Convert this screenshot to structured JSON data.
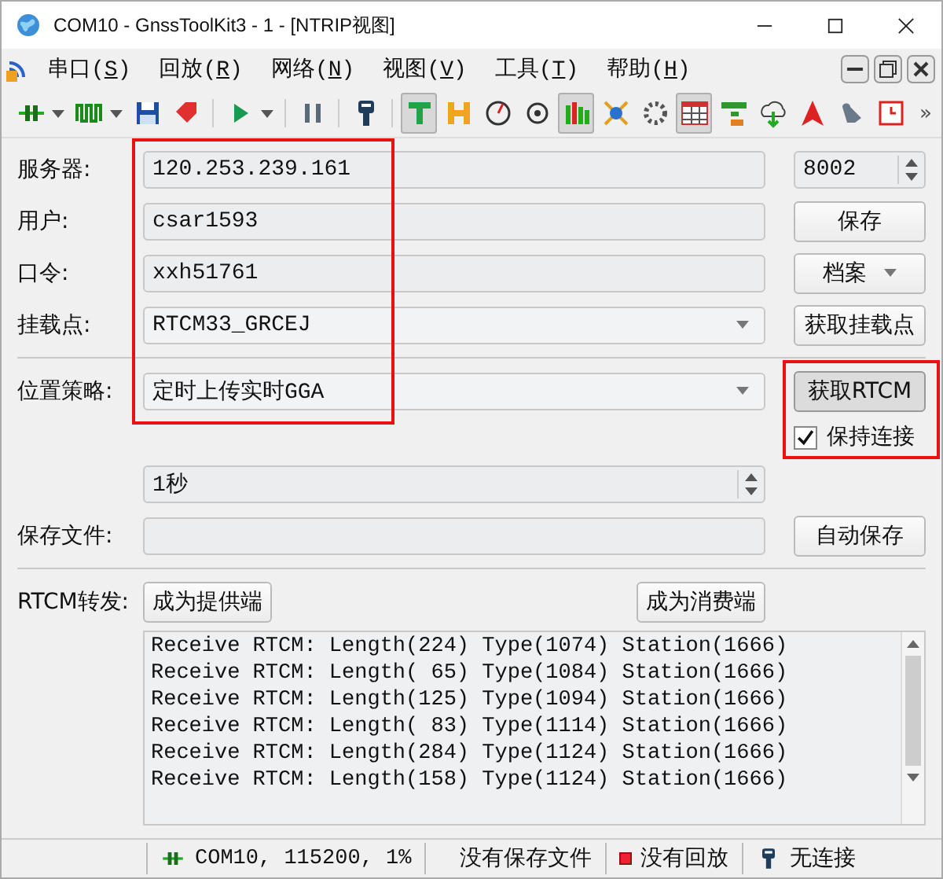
{
  "window": {
    "title": "COM10 - GnssToolKit3 - 1 - [NTRIP视图]"
  },
  "menu": [
    {
      "label": "串口(S)"
    },
    {
      "label": "回放(R)"
    },
    {
      "label": "网络(N)"
    },
    {
      "label": "视图(V)"
    },
    {
      "label": "工具(T)"
    },
    {
      "label": "帮助(H)"
    }
  ],
  "toolbar": [
    {
      "kind": "button",
      "selected": false,
      "menu": true
    },
    {
      "kind": "button",
      "selected": false,
      "menu": true
    },
    {
      "kind": "button",
      "selected": false,
      "menu": false
    },
    {
      "kind": "button",
      "selected": false,
      "menu": false
    },
    {
      "kind": "separator"
    },
    {
      "kind": "button",
      "selected": false,
      "menu": true
    },
    {
      "kind": "separator"
    },
    {
      "kind": "button",
      "selected": false,
      "menu": false
    },
    {
      "kind": "separator"
    },
    {
      "kind": "button",
      "selected": false,
      "menu": false
    },
    {
      "kind": "separator"
    },
    {
      "kind": "button",
      "selected": true,
      "menu": false
    },
    {
      "kind": "button",
      "selected": false,
      "menu": false
    },
    {
      "kind": "button",
      "selected": false,
      "menu": false
    },
    {
      "kind": "button",
      "selected": false,
      "menu": false
    },
    {
      "kind": "button",
      "selected": true,
      "menu": false
    },
    {
      "kind": "button",
      "selected": false,
      "menu": false
    },
    {
      "kind": "button",
      "selected": false,
      "menu": false
    },
    {
      "kind": "button",
      "selected": true,
      "menu": false
    },
    {
      "kind": "button",
      "selected": false,
      "menu": false
    },
    {
      "kind": "button",
      "selected": false,
      "menu": false
    },
    {
      "kind": "button",
      "selected": false,
      "menu": false
    },
    {
      "kind": "button",
      "selected": false,
      "menu": false
    },
    {
      "kind": "button",
      "selected": false,
      "menu": false
    }
  ],
  "toolbar_overflow": "»",
  "form": {
    "server": {
      "label": "服务器:",
      "value": "120.253.239.161",
      "port": "8002"
    },
    "user": {
      "label": "用户:",
      "value": "csar1593",
      "button": "保存"
    },
    "password": {
      "label": "口令:",
      "value": "xxh51761",
      "button": "档案"
    },
    "mountpoint": {
      "label": "挂载点:",
      "value": "RTCM33_GRCEJ",
      "button": "获取挂载点"
    },
    "position": {
      "label": "位置策略:",
      "value": "定时上传实时GGA",
      "button": "获取RTCM",
      "keep_label": "保持连接",
      "keep_checked": true
    },
    "interval": {
      "value": "1秒"
    },
    "save_file": {
      "label": "保存文件:",
      "button": "自动保存"
    },
    "forward": {
      "label": "RTCM转发:",
      "provider": "成为提供端",
      "consumer": "成为消费端"
    }
  },
  "log": [
    "Receive RTCM: Length(224) Type(1074) Station(1666)",
    "Receive RTCM: Length( 65) Type(1084) Station(1666)",
    "Receive RTCM: Length(125) Type(1094) Station(1666)",
    "Receive RTCM: Length( 83) Type(1114) Station(1666)",
    "Receive RTCM: Length(284) Type(1124) Station(1666)",
    "Receive RTCM: Length(158) Type(1124) Station(1666)"
  ],
  "status_bar": {
    "port": "COM10, 115200, 1%",
    "save": "没有保存文件",
    "playback": "没有回放",
    "connection": "无连接"
  }
}
